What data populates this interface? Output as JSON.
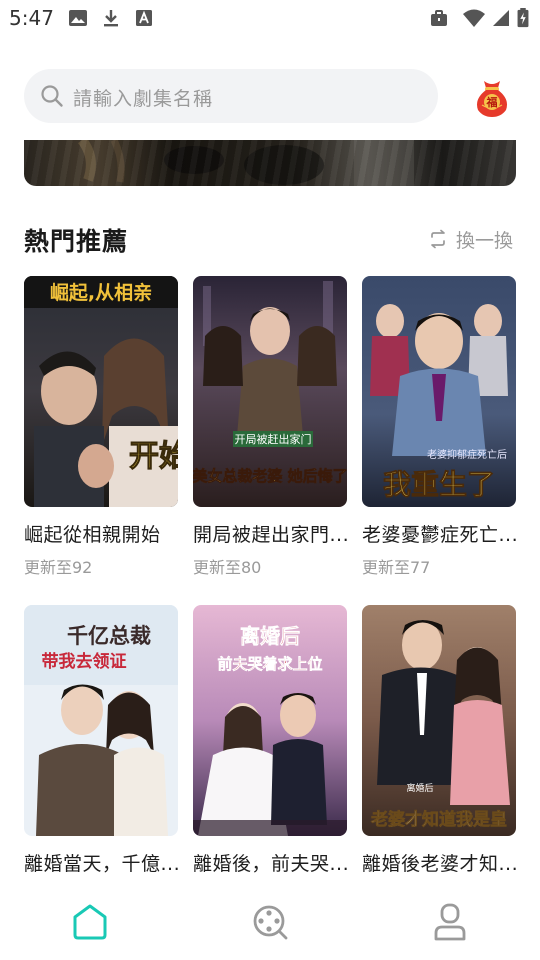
{
  "status_bar": {
    "time": "5:47",
    "left_icons": [
      "image-icon",
      "download-icon",
      "font-icon"
    ],
    "right_icons": [
      "briefcase-icon",
      "wifi-icon",
      "signal-icon",
      "battery-icon"
    ]
  },
  "search": {
    "placeholder": "請輸入劇集名稱",
    "icon": "search-icon"
  },
  "fortune_bag": {
    "icon": "fortune-bag-icon",
    "label": "福"
  },
  "section": {
    "title": "熱門推薦",
    "refresh_label": "換一換"
  },
  "cards": [
    {
      "title": "崛起從相親開始",
      "sub": "更新至92",
      "poster_title": "崛起,从相亲",
      "poster_tag": "开始"
    },
    {
      "title": "開局被趕出家門...",
      "sub": "更新至80",
      "poster_title": "开局被赶出家门",
      "poster_tag": "美女总裁老婆 她后悔了"
    },
    {
      "title": "老婆憂鬱症死亡...",
      "sub": "更新至77",
      "poster_title": "我重生了",
      "poster_tag": "老婆抑郁症死亡后"
    },
    {
      "title": "離婚當天，千億...",
      "sub": "",
      "poster_title": "千亿总裁",
      "poster_tag": "带我去领证"
    },
    {
      "title": "離婚後，前夫哭...",
      "sub": "",
      "poster_title": "离婚后",
      "poster_tag": "前夫哭着求上位"
    },
    {
      "title": "離婚後老婆才知...",
      "sub": "",
      "poster_title": "老婆才知道我是皇",
      "poster_tag": "离婚后"
    }
  ],
  "bottom_nav": [
    {
      "name": "home",
      "icon": "home-icon",
      "active": true
    },
    {
      "name": "discover",
      "icon": "film-reel-icon",
      "active": false
    },
    {
      "name": "profile",
      "icon": "user-icon",
      "active": false
    }
  ],
  "colors": {
    "accent": "#19c9b5",
    "nav_inactive": "#9a9a9a",
    "search_bg": "#f2f3f5",
    "fortune_red": "#e63a2b",
    "fortune_gold": "#f6c24a"
  }
}
